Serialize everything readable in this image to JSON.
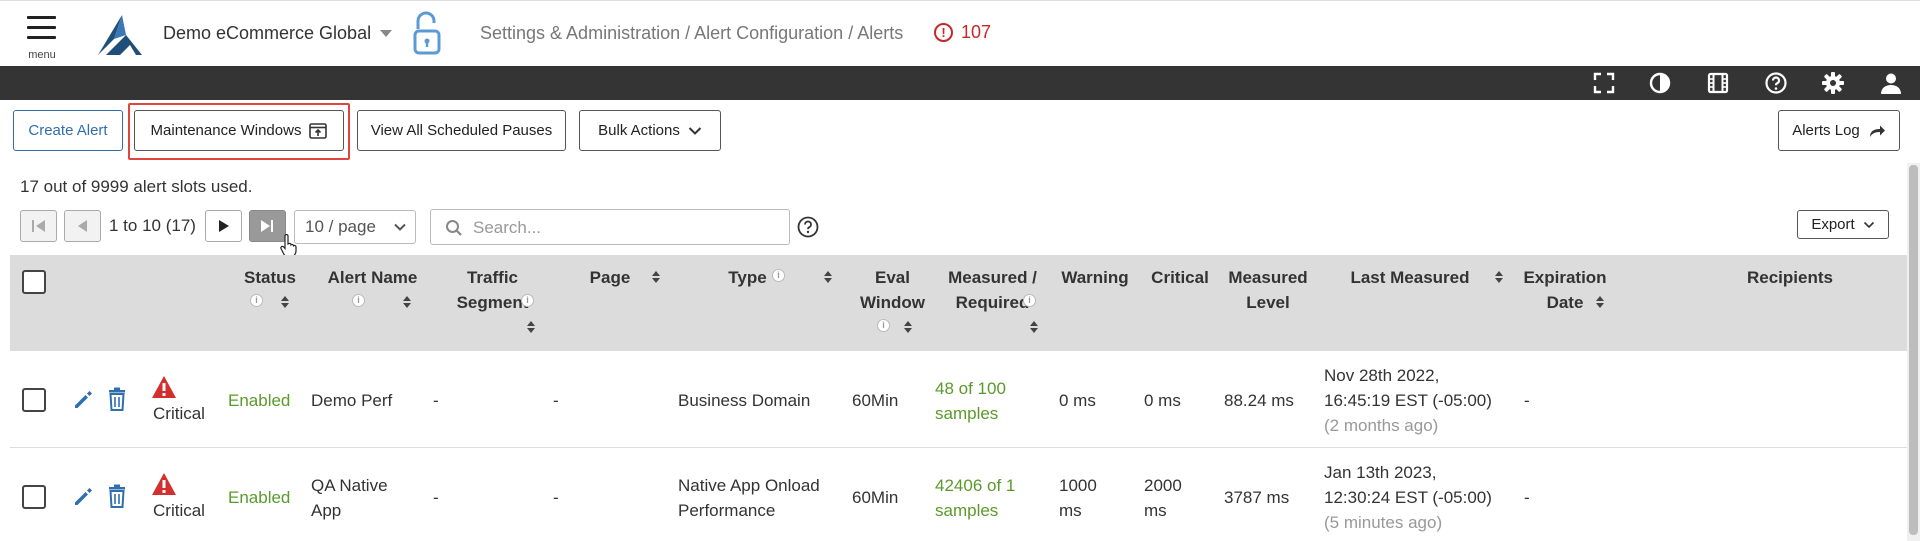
{
  "header": {
    "menu_label": "menu",
    "org_name": "Demo eCommerce Global",
    "breadcrumb": "Settings & Administration / Alert Configuration / Alerts",
    "alert_count": "107"
  },
  "toolbar": {
    "create_alert": "Create Alert",
    "maintenance_windows": "Maintenance Windows",
    "view_all_scheduled_pauses": "View All Scheduled Pauses",
    "bulk_actions": "Bulk Actions",
    "alerts_log": "Alerts Log"
  },
  "slots_text": "17 out of 9999 alert slots used.",
  "pagination": {
    "range": "1 to 10 (17)",
    "per_page": "10 / page"
  },
  "search": {
    "placeholder": "Search..."
  },
  "export_label": "Export",
  "columns": {
    "status": "Status",
    "alert_name": "Alert Name",
    "traffic_segment_1": "Traffic",
    "traffic_segment_2": "Segment",
    "page": "Page",
    "type": "Type",
    "eval_window_1": "Eval",
    "eval_window_2": "Window",
    "measured_required_1": "Measured /",
    "measured_required_2": "Required",
    "warning": "Warning",
    "critical": "Critical",
    "measured_level_1": "Measured",
    "measured_level_2": "Level",
    "last_measured": "Last Measured",
    "expiration_date_1": "Expiration",
    "expiration_date_2": "Date",
    "recipients": "Recipients"
  },
  "rows": [
    {
      "severity": "Critical",
      "status": "Enabled",
      "name_1": "Demo Perf",
      "name_2": "",
      "traffic_segment": "-",
      "page": "-",
      "type_1": "Business Domain",
      "type_2": "",
      "eval_window": "60Min",
      "measured_1": "48 of 100",
      "measured_2": "samples",
      "warning_1": "0 ms",
      "warning_2": "",
      "critical_1": "0 ms",
      "critical_2": "",
      "measured_level": "88.24 ms",
      "last_measured_1": "Nov 28th 2022,",
      "last_measured_2": "16:45:19 EST (-05:00)",
      "last_measured_3": "(2 months ago)",
      "expiration": "-"
    },
    {
      "severity": "Critical",
      "status": "Enabled",
      "name_1": "QA Native",
      "name_2": "App",
      "traffic_segment": "-",
      "page": "-",
      "type_1": "Native App Onload",
      "type_2": "Performance",
      "eval_window": "60Min",
      "measured_1": "42406 of 1",
      "measured_2": "samples",
      "warning_1": "1000",
      "warning_2": "ms",
      "critical_1": "2000",
      "critical_2": "ms",
      "measured_level": "3787 ms",
      "last_measured_1": "Jan 13th 2023,",
      "last_measured_2": "12:30:24 EST (-05:00)",
      "last_measured_3": "(5 minutes ago)",
      "expiration": "-"
    }
  ],
  "colors": {
    "accent_blue": "#2f6fb0",
    "enabled_green": "#5a9a2c",
    "critical_red": "#d32f2f",
    "highlight_red": "#e0463f",
    "dark_bar": "#343434"
  }
}
